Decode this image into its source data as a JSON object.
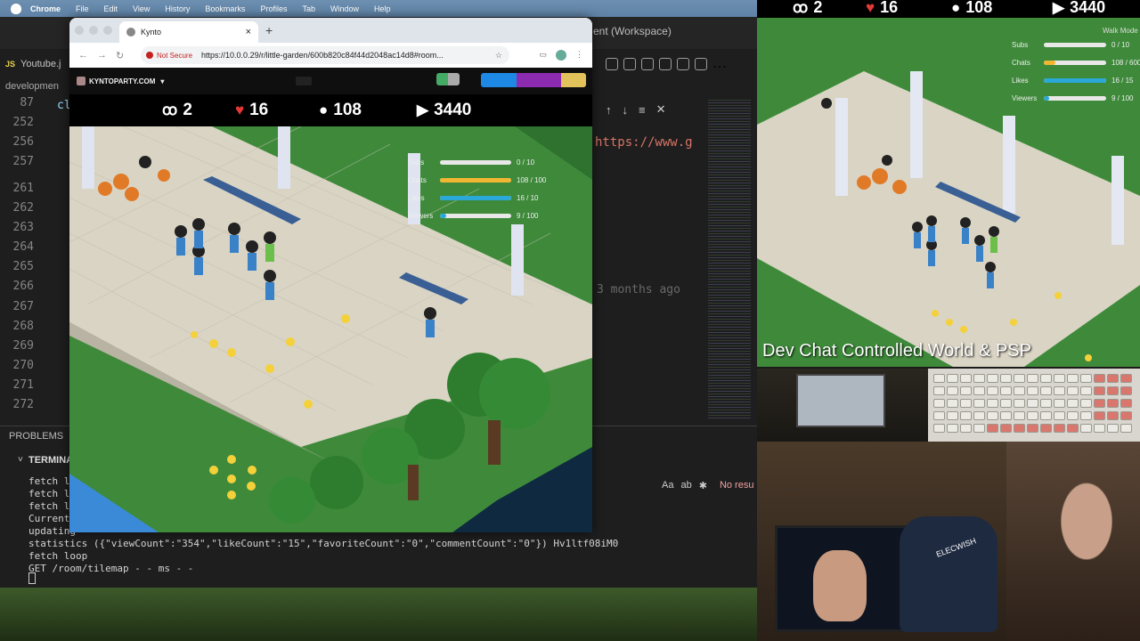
{
  "menubar": {
    "app": "Chrome",
    "items": [
      "File",
      "Edit",
      "View",
      "History",
      "Bookmarks",
      "Profiles",
      "Tab",
      "Window",
      "Help"
    ]
  },
  "editor": {
    "workspace_title": "ent (Workspace)",
    "tab": {
      "badge": "JS",
      "label": "Youtube.j"
    },
    "breadcrumb_a": "developmen",
    "breadcrumb_b": "cl",
    "line_numbers": [
      "87",
      "252",
      "256",
      "257",
      "261",
      "262",
      "263",
      "264",
      "265",
      "266",
      "267",
      "268",
      "269",
      "270",
      "271",
      "272"
    ],
    "url_snippet": "https://www.g",
    "blame": "3 months ago",
    "problems": "PROBLEMS",
    "terminal_label": "TERMINA",
    "find": {
      "aa": "Aa",
      "ab": "ab",
      "no_results": "No resu"
    },
    "terminal_lines": [
      "fetch l",
      "fetch l",
      "fetch l",
      "Current",
      "updating",
      "statistics ({\"viewCount\":\"354\",\"likeCount\":\"15\",\"favoriteCount\":\"0\",\"commentCount\":\"0\"}) Hv1ltf08iM0",
      "fetch loop",
      "GET /room/tilemap - - ms - -"
    ]
  },
  "browser": {
    "tab_title": "Kynto",
    "close": "×",
    "new_tab": "+",
    "not_secure": "Not Secure",
    "url": "https://10.0.0.29/r/little-garden/600b820c84f44d2048ac14d8#room...",
    "star": "☆",
    "brand": "KYNTOPARTY.COM",
    "caret": "▾"
  },
  "stats": {
    "players": "2",
    "likes": "16",
    "chats": "108",
    "views": "3440"
  },
  "bars": [
    {
      "label": "Subs",
      "value": "0 / 10",
      "fraction": 0.0,
      "color": "#ffffff"
    },
    {
      "label": "Chats",
      "value": "108 / 100",
      "fraction": 1.0,
      "color": "#f2b630"
    },
    {
      "label": "Likes",
      "value": "16 / 10",
      "fraction": 1.0,
      "color": "#2aa8d8"
    },
    {
      "label": "Viewers",
      "value": "9 / 100",
      "fraction": 0.09,
      "color": "#2aa8d8"
    }
  ],
  "bars_right": [
    {
      "label": "Subs",
      "value": "0 / 10",
      "fraction": 0.0,
      "color": "#ffffff"
    },
    {
      "label": "Chats",
      "value": "108 / 600",
      "fraction": 0.18,
      "color": "#f2b630"
    },
    {
      "label": "Likes",
      "value": "16 / 15",
      "fraction": 1.0,
      "color": "#2aa8d8"
    },
    {
      "label": "Viewers",
      "value": "9 / 100",
      "fraction": 0.09,
      "color": "#2aa8d8"
    }
  ],
  "right": {
    "walk_mode": "Walk Mode",
    "caption": "Dev Chat Controlled World & PSP",
    "chair_brand": "ELECWISH"
  }
}
